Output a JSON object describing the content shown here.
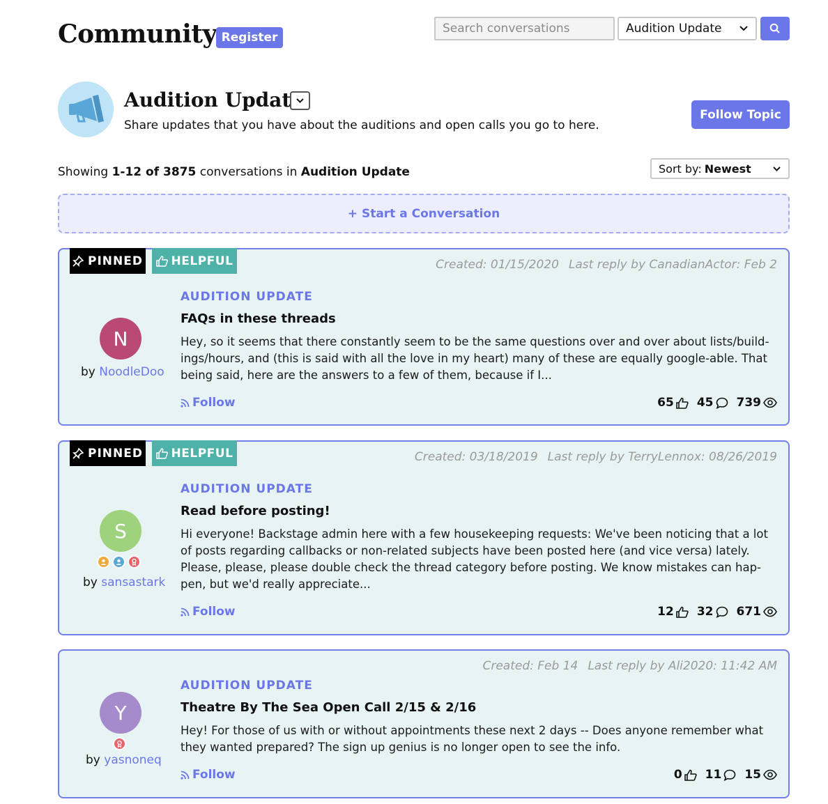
{
  "header": {
    "site_title": "Community",
    "register_label": "Register",
    "search_placeholder": "Search conversations",
    "topic_select_value": "Audition Update"
  },
  "topic": {
    "title": "Audition Update",
    "description": "Share updates that you have about the auditions and open calls you go to here.",
    "follow_label": "Follow Topic"
  },
  "listing": {
    "showing_prefix": "Showing ",
    "range": "1-12 of 3875",
    "mid": " conversations in ",
    "topic": "Audition Update",
    "sort_label": "Sort by:",
    "sort_value": "Newest",
    "start_label": "+ Start a Conversation"
  },
  "posts": [
    {
      "pinned_label": "PINNED",
      "helpful_label": "HELPFUL",
      "created": "Created: 01/15/2020",
      "last_reply": "Last reply by CanadianActor: Feb 2",
      "category": "AUDITION UPDATE",
      "title": "FAQs in these threads",
      "excerpt": "Hey, so it seems that there constantly seem to be the same questions over and over about lists/build-ings/hours, and (this is said with all the love in my heart) many of these are equally google-able. That being said, here are the answers to a few of them, because if I...",
      "avatar_letter": "N",
      "avatar_color": "#b84a73",
      "by": "by ",
      "author": "NoodleDoo",
      "follow_label": "Follow",
      "likes": "65",
      "comments": "45",
      "views": "739"
    },
    {
      "pinned_label": "PINNED",
      "helpful_label": "HELPFUL",
      "created": "Created: 03/18/2019",
      "last_reply": "Last reply by TerryLennox: 08/26/2019",
      "category": "AUDITION UPDATE",
      "title": "Read before posting!",
      "excerpt": "Hi everyone! Backstage admin here with a few housekeeping requests: We've been noticing that a lot of posts regarding callbacks or non-related subjects have been posted here (and vice versa) lately. Please, please, please double check the thread category before posting. We know mistakes can hap-pen, but we'd really appreciate...",
      "avatar_letter": "S",
      "avatar_color": "#9fd27c",
      "by": "by ",
      "author": "sansastark",
      "follow_label": "Follow",
      "likes": "12",
      "comments": "32",
      "views": "671"
    },
    {
      "created": "Created: Feb 14",
      "last_reply": "Last reply by Ali2020: 11:42 AM",
      "category": "AUDITION UPDATE",
      "title": "Theatre By The Sea Open Call 2/15 & 2/16",
      "excerpt": "Hey! For those of us with or without appointments these next 2 days -- Does anyone remember what they wanted prepared? The sign up genius is no longer open to see the info.",
      "avatar_letter": "Y",
      "avatar_color": "#a58bcb",
      "by": "by ",
      "author": "yasnoneq",
      "follow_label": "Follow",
      "likes": "0",
      "comments": "11",
      "views": "15"
    }
  ],
  "colors": {
    "accent": "#6b77e8",
    "card_bg": "#e7f4f3",
    "helpful": "#4fb2a8",
    "badge_orange": "#f0a93a",
    "badge_blue": "#5aa8d8",
    "badge_red": "#e7646a"
  }
}
